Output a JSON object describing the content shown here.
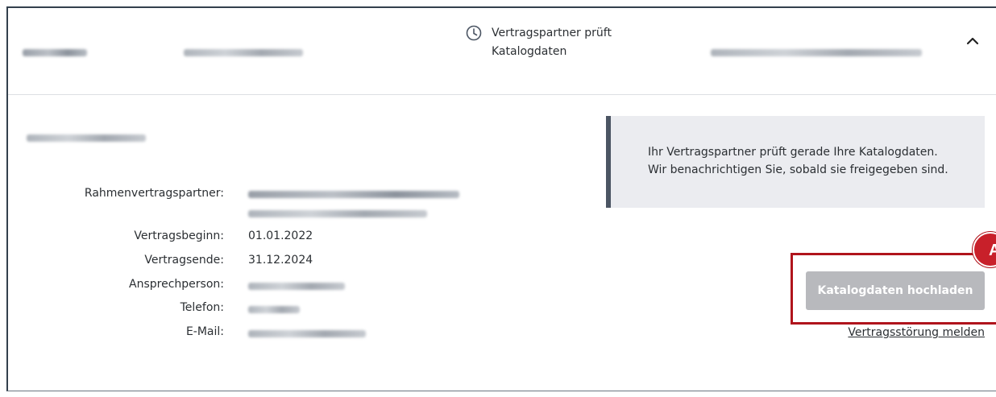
{
  "header": {
    "status_text": "Vertragspartner prüft Katalogdaten",
    "status_icon": "clock-icon",
    "collapse_icon": "chevron-up-icon"
  },
  "details": {
    "labels": {
      "partner": "Rahmenvertragspartner:",
      "start": "Vertragsbeginn:",
      "end": "Vertragsende:",
      "contact": "Ansprechperson:",
      "phone": "Telefon:",
      "email": "E-Mail:"
    },
    "values": {
      "start": "01.01.2022",
      "end": "31.12.2024"
    }
  },
  "info": {
    "line1": "Ihr Vertragspartner prüft gerade Ihre Katalogdaten.",
    "line2": "Wir benachrichtigen Sie, sobald sie freigegeben sind."
  },
  "actions": {
    "upload_label": "Katalogdaten hochladen",
    "report_label": "Vertragsstörung melden",
    "badge_label": "A"
  },
  "colors": {
    "highlight": "#b0141c",
    "button_disabled": "#b8b9bd",
    "info_border": "#4b5563",
    "info_bg": "#ebecf0"
  }
}
